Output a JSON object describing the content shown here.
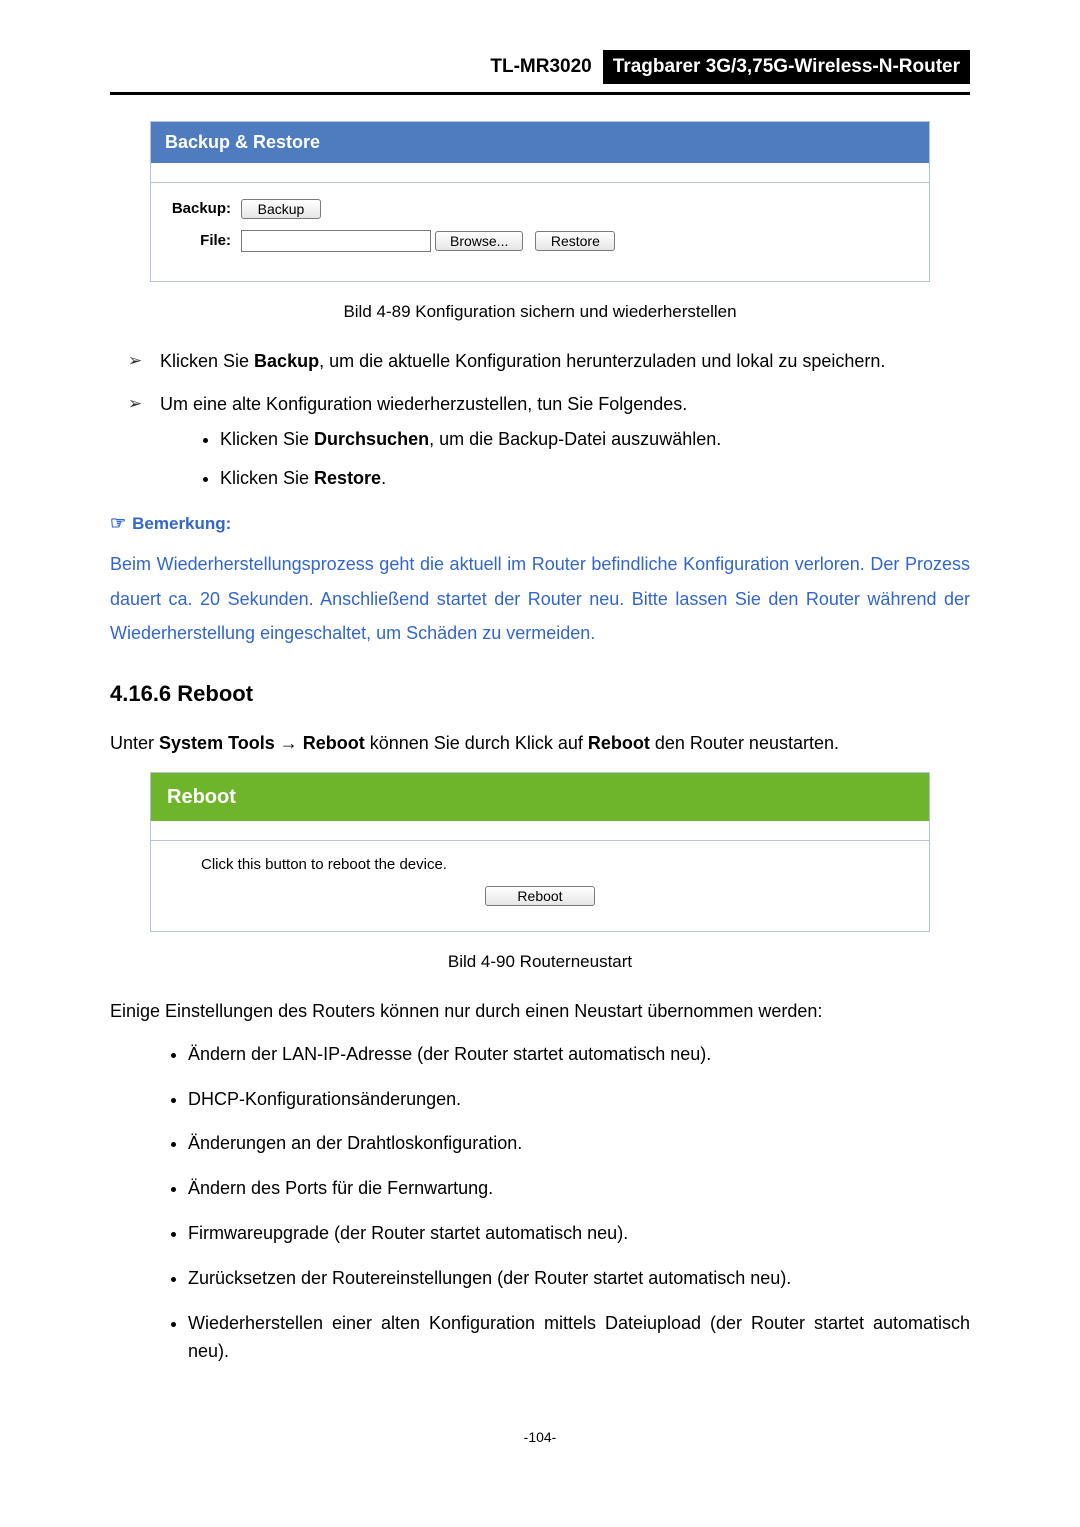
{
  "header": {
    "model": "TL-MR3020",
    "subtitle": "Tragbarer 3G/3,75G-Wireless-N-Router"
  },
  "backup_panel": {
    "title": "Backup & Restore",
    "backup_label": "Backup:",
    "backup_button": "Backup",
    "file_label": "File:",
    "file_value": "",
    "browse_button": "Browse...",
    "restore_button": "Restore"
  },
  "fig1_caption": "Bild 4-89 Konfiguration sichern und wiederherstellen",
  "steps": {
    "arrow1_pre": "Klicken Sie ",
    "arrow1_bold": "Backup",
    "arrow1_post": ", um die aktuelle Konfiguration herunterzuladen und lokal zu speichern.",
    "arrow2": "Um eine alte Konfiguration wiederherzustellen, tun Sie Folgendes.",
    "sub1_pre": "Klicken Sie ",
    "sub1_bold": "Durchsuchen",
    "sub1_post": ", um die Backup-Datei auszuwählen.",
    "sub2_pre": "Klicken Sie ",
    "sub2_bold": "Restore",
    "sub2_post": "."
  },
  "note": {
    "title": "Bemerkung:",
    "body": "Beim Wiederherstellungsprozess geht die aktuell im Router befindliche Konfiguration verloren. Der Prozess dauert ca. 20 Sekunden. Anschließend startet der Router neu. Bitte lassen Sie den Router während der Wiederherstellung eingeschaltet, um Schäden zu vermeiden."
  },
  "section": {
    "heading": "4.16.6  Reboot",
    "intro_pre": "Unter ",
    "intro_b1": "System Tools → Reboot",
    "intro_mid": " können Sie durch Klick auf ",
    "intro_b2": "Reboot",
    "intro_post": " den Router neustarten."
  },
  "reboot_panel": {
    "title": "Reboot",
    "text": "Click this button to reboot the device.",
    "button": "Reboot"
  },
  "fig2_caption": "Bild 4-90 Routerneustart",
  "restart_intro": "Einige Einstellungen des Routers können nur durch einen Neustart übernommen werden:",
  "restart_items": {
    "i1": "Ändern der LAN-IP-Adresse (der Router startet automatisch neu).",
    "i2": "DHCP-Konfigurationsänderungen.",
    "i3": "Änderungen an der Drahtloskonfiguration.",
    "i4": "Ändern des Ports für die Fernwartung.",
    "i5": "Firmwareupgrade (der Router startet automatisch neu).",
    "i6": "Zurücksetzen der Routereinstellungen (der Router startet automatisch neu).",
    "i7": "Wiederherstellen einer alten Konfiguration mittels Dateiupload (der Router startet automatisch neu)."
  },
  "page_number": "-104-"
}
